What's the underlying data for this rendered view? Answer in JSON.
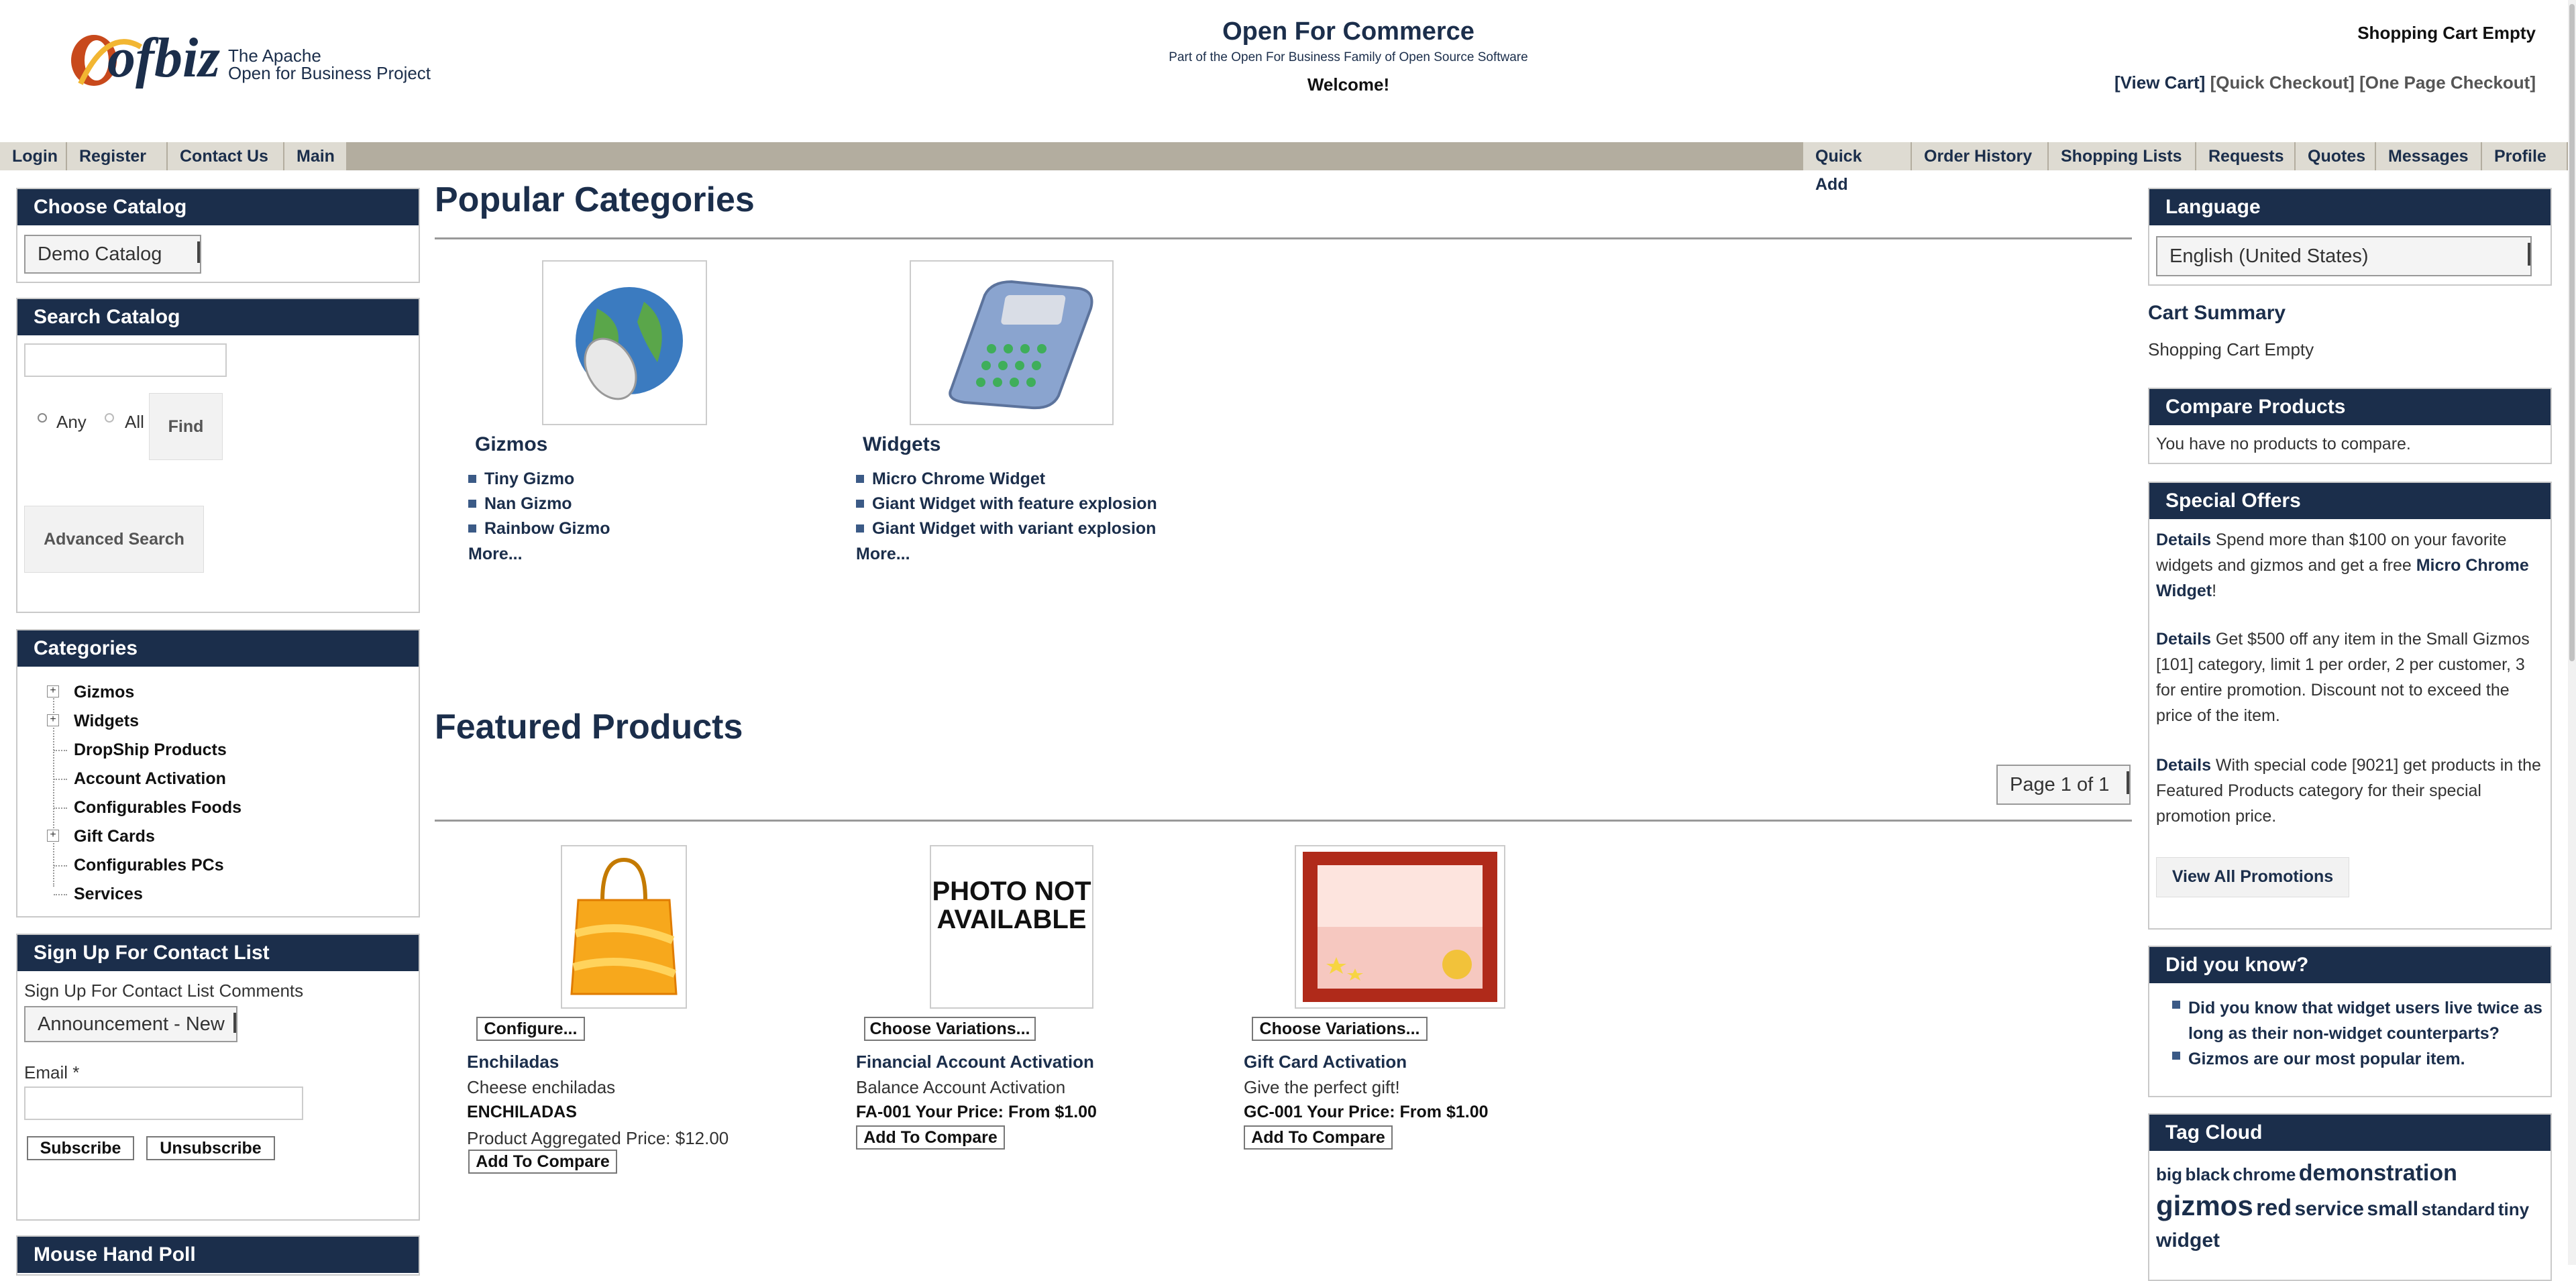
{
  "header": {
    "logo_text": "ofbiz",
    "logo_sub1": "The Apache",
    "logo_sub2": "Open for Business Project",
    "title": "Open For Commerce",
    "subtitle": "Part of the Open For Business Family of Open Source Software",
    "welcome": "Welcome!",
    "cart_status": "Shopping Cart Empty",
    "cart_links": [
      "[View Cart]",
      "[Quick Checkout]",
      "[One Page Checkout]"
    ]
  },
  "nav": {
    "left": [
      "Login",
      "Register",
      "Contact Us",
      "Main"
    ],
    "right": [
      "Quick Add",
      "Order History",
      "Shopping Lists",
      "Requests",
      "Quotes",
      "Messages",
      "Profile"
    ]
  },
  "left": {
    "choose_catalog": {
      "title": "Choose Catalog",
      "selected": "Demo Catalog"
    },
    "search": {
      "title": "Search Catalog",
      "any": "Any",
      "all": "All",
      "find": "Find",
      "advanced": "Advanced Search"
    },
    "categories": {
      "title": "Categories",
      "items": [
        {
          "label": "Gizmos",
          "expandable": true
        },
        {
          "label": "Widgets",
          "expandable": true
        },
        {
          "label": "DropShip Products",
          "expandable": false
        },
        {
          "label": "Account Activation",
          "expandable": false
        },
        {
          "label": "Configurables Foods",
          "expandable": false
        },
        {
          "label": "Gift Cards",
          "expandable": true
        },
        {
          "label": "Configurables PCs",
          "expandable": false
        },
        {
          "label": "Services",
          "expandable": false
        }
      ]
    },
    "signup": {
      "title": "Sign Up For Contact List",
      "comments_label": "Sign Up For Contact List Comments",
      "selected": "Announcement - New",
      "email_label": "Email *",
      "subscribe": "Subscribe",
      "unsubscribe": "Unsubscribe"
    },
    "poll": {
      "title": "Mouse Hand Poll"
    }
  },
  "main": {
    "popular_title": "Popular Categories",
    "popular": [
      {
        "title": "Gizmos",
        "items": [
          "Tiny Gizmo",
          "Nan Gizmo",
          "Rainbow Gizmo"
        ],
        "more": "More..."
      },
      {
        "title": "Widgets",
        "items": [
          "Micro Chrome Widget",
          "Giant Widget with feature explosion",
          "Giant Widget with variant explosion"
        ],
        "more": "More..."
      }
    ],
    "featured_title": "Featured Products",
    "pager": "Page 1 of 1",
    "products": [
      {
        "button": "Configure...",
        "name": "Enchiladas",
        "desc": "Cheese enchiladas",
        "code": "ENCHILADAS",
        "price": "Product Aggregated Price: $12.00",
        "compare": "Add To Compare"
      },
      {
        "button": "Choose Variations...",
        "name": "Financial Account Activation",
        "desc": "Balance Account Activation",
        "price": "FA-001 Your Price: From $1.00",
        "compare": "Add To Compare",
        "photo_text": "PHOTO NOT AVAILABLE"
      },
      {
        "button": "Choose Variations...",
        "name": "Gift Card Activation",
        "desc": "Give the perfect gift!",
        "price": "GC-001 Your Price: From $1.00",
        "compare": "Add To Compare"
      }
    ]
  },
  "right": {
    "language": {
      "title": "Language",
      "selected": "English (United States)"
    },
    "cart_summary": {
      "title": "Cart Summary",
      "text": "Shopping Cart Empty"
    },
    "compare": {
      "title": "Compare Products",
      "text": "You have no products to compare."
    },
    "special": {
      "title": "Special Offers",
      "offers": [
        {
          "link": "Details",
          "text": " Spend more than $100 on your favorite widgets and gizmos and get a free ",
          "link2": "Micro Chrome Widget",
          "end": "!"
        },
        {
          "link": "Details",
          "text": " Get $500 off any item in the Small Gizmos [101] category, limit 1 per order, 2 per customer, 3 for entire promotion. Discount not to exceed the price of the item."
        },
        {
          "link": "Details",
          "text": " With special code [9021] get products in the Featured Products category for their special promotion price."
        }
      ],
      "view_all": "View All Promotions"
    },
    "didyouknow": {
      "title": "Did you know?",
      "items": [
        "Did you know that widget users live twice as long as their non-widget counterparts?",
        "Gizmos are our most popular item."
      ]
    },
    "tagcloud": {
      "title": "Tag Cloud",
      "tags": [
        "big",
        "black",
        "chrome",
        "demonstration",
        "gizmos",
        "red",
        "service",
        "small",
        "standard",
        "tiny",
        "widget"
      ]
    }
  },
  "colors": {
    "header_bg": "#1b2e4b",
    "nav_bg": "#b3ad9f",
    "nav_item_bg": "#dedbd2",
    "link": "#1b2e4b"
  }
}
